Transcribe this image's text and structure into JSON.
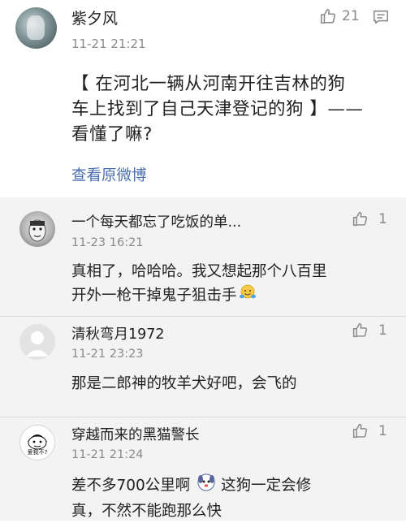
{
  "main_comment": {
    "author": "紫夕风",
    "time": "11-21 21:21",
    "likes": "21",
    "text_lines": [
      "【 在河北一辆从河南开往吉林的狗",
      "车上找到了自己天津登记的狗 】——",
      "看懂了嘛?"
    ],
    "link_label": "查看原微博",
    "icons": {
      "like": "thumbs-up-icon",
      "comment": "comment-icon"
    }
  },
  "replies": [
    {
      "author": "一个每天都忘了吃饭的单...",
      "time": "11-23 16:21",
      "likes": "1",
      "text_lines": [
        "真相了，哈哈哈。我又想起那个八百里",
        "开外一枪干掉鬼子狙击手"
      ]
    },
    {
      "author": "清秋弯月1972",
      "time": "11-21 23:23",
      "likes": "1",
      "text_lines": [
        "那是二郎神的牧羊犬好吧，会飞的"
      ]
    },
    {
      "author": "穿越而来的黑猫警长",
      "time": "11-21 21:24",
      "likes": "1",
      "avatar_caption": "爱我不?",
      "text_lines": [
        "差不多700公里啊",
        "这狗一定会修",
        "真，不然不能跑那么快"
      ]
    }
  ],
  "colors": {
    "link": "#4a6fb0",
    "muted": "#8a8a8a",
    "reply_bg": "#f3f3f3"
  }
}
